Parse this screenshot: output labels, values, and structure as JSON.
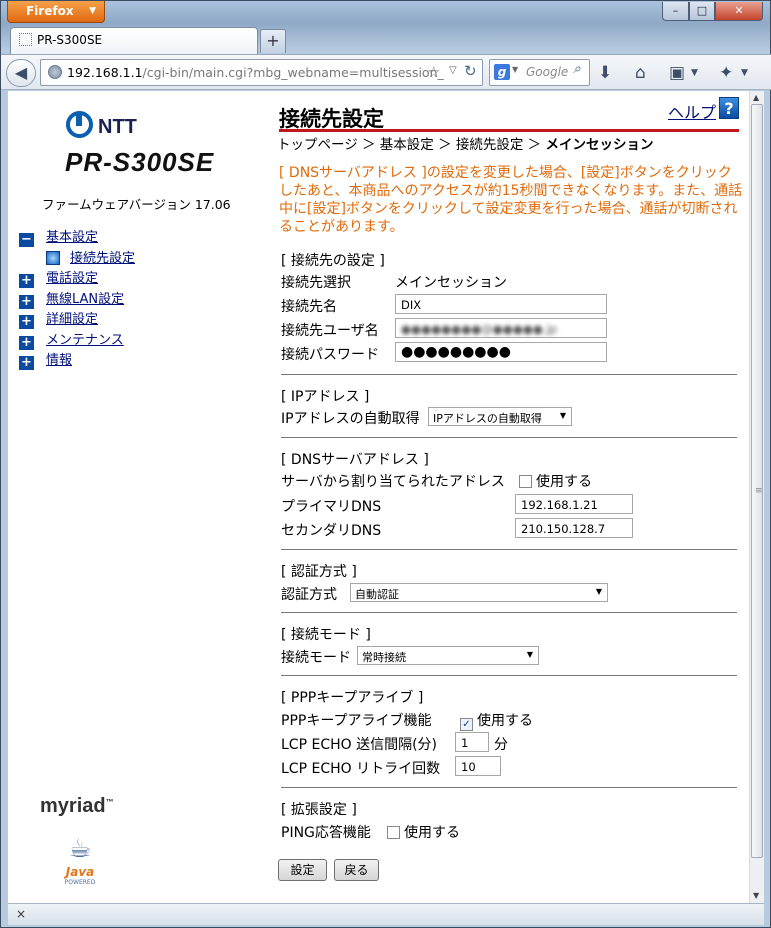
{
  "browser": {
    "app_button": "Firefox",
    "tab_title": "PR-S300SE",
    "new_tab": "+",
    "url_host": "192.168.1.1",
    "url_path": "/cgi-bin/main.cgi?mbg_webname=multisession_",
    "search_placeholder": "Google",
    "status_close": "×",
    "window_controls": {
      "minimize": "–",
      "maximize": "□",
      "close": "✕"
    }
  },
  "sidebar": {
    "brand": "NTT",
    "model": "PR-S300SE",
    "firmware": "ファームウェアバージョン 17.06",
    "items": [
      {
        "label": "基本設定",
        "marker": "−"
      },
      {
        "label": "接続先設定",
        "marker": ""
      },
      {
        "label": "電話設定",
        "marker": "+"
      },
      {
        "label": "無線LAN設定",
        "marker": "+"
      },
      {
        "label": "詳細設定",
        "marker": "+"
      },
      {
        "label": "メンテナンス",
        "marker": "+"
      },
      {
        "label": "情報",
        "marker": "+"
      }
    ],
    "myriad": "myriad",
    "java": "Java",
    "java_powered": "POWERED"
  },
  "main": {
    "title": "接続先設定",
    "help_label": "ヘルプ",
    "help_icon": "?",
    "breadcrumb": {
      "path": "トップページ ＞ 基本設定 ＞ 接続先設定 ＞",
      "current": "メインセッション"
    },
    "warning": "[ DNSサーバアドレス ]の設定を変更した場合、[設定]ボタンをクリックしたあと、本商品へのアクセスが約15秒間できなくなります。また、通話中に[設定]ボタンをクリックして設定変更を行った場合、通話が切断されることがあります。",
    "sections": {
      "connection": {
        "header": "[ 接続先の設定 ]",
        "select_label": "接続先選択",
        "select_value": "メインセッション",
        "name_label": "接続先名",
        "name_value": "DIX",
        "user_label": "接続先ユーザ名",
        "user_value": "●●●●●●●●@●●●●●.jp",
        "password_label": "接続パスワード",
        "password_value": "●●●●●●●●●"
      },
      "ip": {
        "header": "[ IPアドレス ]",
        "auto_label": "IPアドレスの自動取得",
        "auto_value": "IPアドレスの自動取得"
      },
      "dns": {
        "header": "[ DNSサーバアドレス ]",
        "assigned_label": "サーバから割り当てられたアドレス",
        "use_label": "使用する",
        "primary_label": "プライマリDNS",
        "primary_value": "192.168.1.21",
        "secondary_label": "セカンダリDNS",
        "secondary_value": "210.150.128.7"
      },
      "auth": {
        "header": "[ 認証方式 ]",
        "label": "認証方式",
        "value": "自動認証"
      },
      "mode": {
        "header": "[ 接続モード ]",
        "label": "接続モード",
        "value": "常時接続"
      },
      "ppp": {
        "header": "[ PPPキープアライブ ]",
        "func_label": "PPPキープアライブ機能",
        "use_label": "使用する",
        "interval_label": "LCP ECHO 送信間隔(分)",
        "interval_value": "1",
        "interval_unit": "分",
        "retry_label": "LCP ECHO リトライ回数",
        "retry_value": "10"
      },
      "ext": {
        "header": "[ 拡張設定 ]",
        "ping_label": "PING応答機能",
        "use_label": "使用する"
      }
    },
    "buttons": {
      "save": "設定",
      "back": "戻る"
    }
  }
}
